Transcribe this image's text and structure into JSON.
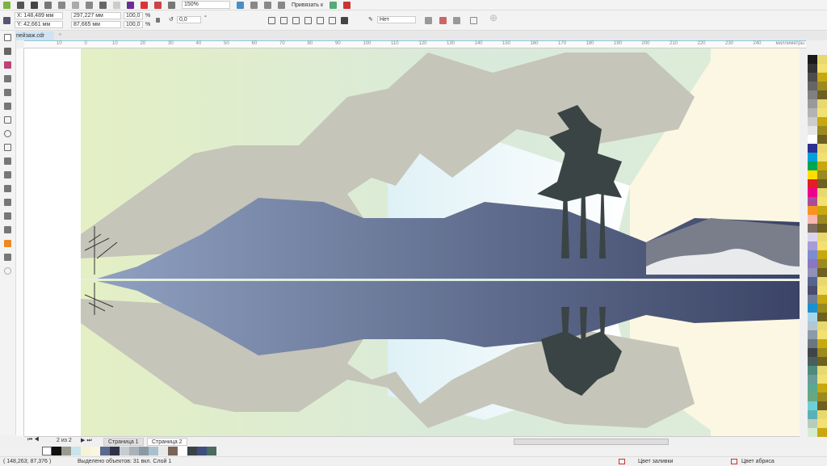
{
  "toolbar": {
    "zoom": "150%",
    "snap_label": "Привязать к"
  },
  "props": {
    "x": "X: 148,489 мм",
    "y": "Y: 42,661 мм",
    "width": "297,227 мм",
    "height": "87,665 мм",
    "scale_x": "100,0",
    "scale_y": "100,0",
    "pct": "%",
    "angle": "0,0",
    "deg": "°",
    "outline": "Нет"
  },
  "tabs": {
    "doc": "пейзаж.cdr",
    "add": "+"
  },
  "ruler": {
    "ticks": [
      "10",
      "0",
      "10",
      "20",
      "30",
      "40",
      "50",
      "60",
      "70",
      "80",
      "90",
      "100",
      "110",
      "120",
      "130",
      "140",
      "150",
      "160",
      "170",
      "180",
      "190",
      "200",
      "210",
      "220",
      "230",
      "240"
    ],
    "unit": "миллиметры"
  },
  "nav": {
    "page_count": "2 из 2",
    "pages": [
      "Страница 1",
      "Страница 2"
    ]
  },
  "status": {
    "coords": "( 148,263; 87,376 )",
    "selection": "Выделено объектов: 31 вкл. Слой 1",
    "fill": "Цвет заливки",
    "outline": "Цвет абриса"
  },
  "colors": {
    "doc_palette": [
      "#111111",
      "#9a9a8e",
      "#c8e4ec",
      "#f7f3d6",
      "#faf6e0",
      "#5a6a8e",
      "#2f3448",
      "#c7ccd0",
      "#a9b2b8",
      "#8a9aa4",
      "#aac0cc",
      "#e8eaea",
      "#7a6458",
      "#ffffff",
      "#3a4246",
      "#3d4e7e",
      "#4a6a62"
    ],
    "right_palette": [
      "#1a1a1a",
      "#333333",
      "#4d4d4d",
      "#666666",
      "#808080",
      "#999999",
      "#b3b3b3",
      "#cccccc",
      "#e6e6e6",
      "#ffffff",
      "#2e3192",
      "#00a0dc",
      "#00a651",
      "#ffde00",
      "#e31e24",
      "#ec008c",
      "#a94d9a",
      "#f7941d",
      "#f9b7b4",
      "#7d6c61",
      "#d9d4ee",
      "#a99ad8",
      "#7b8dd0",
      "#8a76c4",
      "#9290b8",
      "#56658f",
      "#4c4c6e",
      "#6a7d9a",
      "#1a90cf",
      "#a6d5ea",
      "#b3c6d2",
      "#8e9aa6",
      "#6a7680",
      "#3e4448",
      "#4a5e5c",
      "#4f8a7c",
      "#6a9c96",
      "#5aa890",
      "#68a880",
      "#6ecfd8",
      "#5bb0b8",
      "#b8ccbc",
      "#d6ecd0"
    ]
  }
}
